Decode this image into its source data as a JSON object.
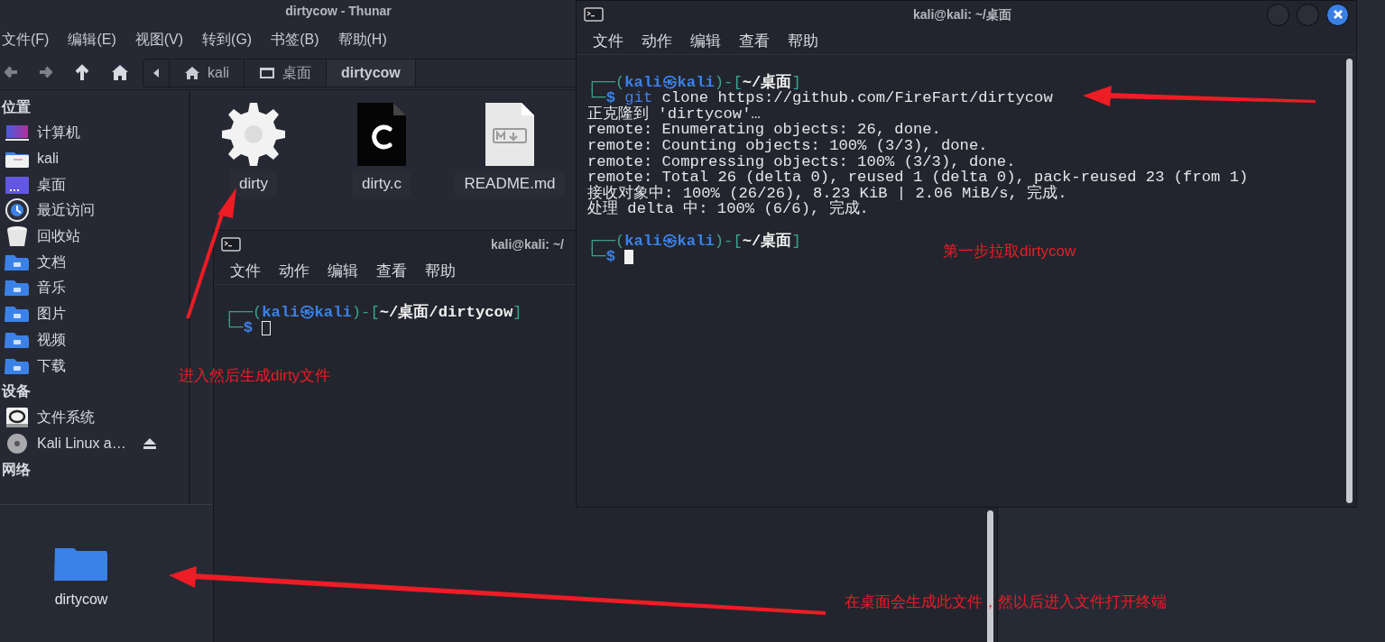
{
  "thunar": {
    "title": "dirtycow - Thunar",
    "menu": [
      "文件(F)",
      "编辑(E)",
      "视图(V)",
      "转到(G)",
      "书签(B)",
      "帮助(H)"
    ],
    "path": [
      {
        "label": "kali",
        "kind": "home",
        "selected": false
      },
      {
        "label": "桌面",
        "kind": "desktop",
        "selected": false
      },
      {
        "label": "dirtycow",
        "kind": "plain",
        "selected": true
      }
    ],
    "sidebar": [
      {
        "heading": "位置",
        "items": [
          {
            "label": "计算机",
            "kind": "computer"
          },
          {
            "label": "kali",
            "kind": "home"
          },
          {
            "label": "桌面",
            "kind": "desktop"
          },
          {
            "label": "最近访问",
            "kind": "recent"
          },
          {
            "label": "回收站",
            "kind": "trash"
          },
          {
            "label": "文档",
            "kind": "folder"
          },
          {
            "label": "音乐",
            "kind": "folder"
          },
          {
            "label": "图片",
            "kind": "folder"
          },
          {
            "label": "视频",
            "kind": "folder"
          },
          {
            "label": "下载",
            "kind": "folder"
          }
        ]
      },
      {
        "heading": "设备",
        "items": [
          {
            "label": "文件系统",
            "kind": "drive"
          },
          {
            "label": "Kali Linux a…",
            "kind": "disc",
            "eject": true
          }
        ]
      },
      {
        "heading": "网络"
      }
    ],
    "files": [
      {
        "name": "dirty",
        "kind": "executable"
      },
      {
        "name": "dirty.c",
        "kind": "c-source"
      },
      {
        "name": "README.md",
        "kind": "markdown"
      }
    ]
  },
  "terminals": [
    {
      "title": "kali@kali: ~/",
      "menu": [
        "文件",
        "动作",
        "编辑",
        "查看",
        "帮助"
      ],
      "lines": [
        {
          "kind": "blank"
        },
        {
          "kind": "prompt",
          "open": "┌──(",
          "user": "kali㉿kali",
          "mid": ")-[",
          "path": "~/桌面/dirtycow",
          "close": "]",
          "corner": "└─",
          "sign": "$",
          "cursor": true
        }
      ]
    },
    {
      "title": "kali@kali: ~/桌面",
      "menu": [
        "文件",
        "动作",
        "编辑",
        "查看",
        "帮助"
      ],
      "lines": [
        {
          "kind": "blank"
        },
        {
          "kind": "prompt",
          "open": "┌──(",
          "user": "kali㉿kali",
          "mid": ")-[",
          "path": "~/桌面",
          "close": "]",
          "corner": "└─",
          "sign": "$",
          "program": "git",
          "args": "clone https://github.com/FireFart/dirtycow",
          "cursor": false
        },
        {
          "kind": "output",
          "text": "正克隆到 'dirtycow'…"
        },
        {
          "kind": "output",
          "text": "remote: Enumerating objects: 26, done."
        },
        {
          "kind": "output",
          "text": "remote: Counting objects: 100% (3/3), done."
        },
        {
          "kind": "output",
          "text": "remote: Compressing objects: 100% (3/3), done."
        },
        {
          "kind": "output",
          "text": "remote: Total 26 (delta 0), reused 1 (delta 0), pack-reused 23 (from 1)"
        },
        {
          "kind": "output",
          "text": "接收对象中: 100% (26/26), 8.23 KiB | 2.06 MiB/s, 完成."
        },
        {
          "kind": "output",
          "text": "处理 delta 中: 100% (6/6), 完成."
        },
        {
          "kind": "blank"
        },
        {
          "kind": "prompt",
          "open": "┌──(",
          "user": "kali㉿kali",
          "mid": ")-[",
          "path": "~/桌面",
          "close": "]",
          "corner": "└─",
          "sign": "$",
          "cursor": true
        }
      ]
    }
  ],
  "desktop": {
    "icons": [
      {
        "label": "dirtycow",
        "kind": "folder"
      }
    ]
  },
  "annotations": [
    {
      "text": "进入然后生成dirty文件"
    },
    {
      "text": "第一步拉取dirtycow"
    },
    {
      "text": "在桌面会生成此文件，然以后进入文件打开终端"
    }
  ]
}
